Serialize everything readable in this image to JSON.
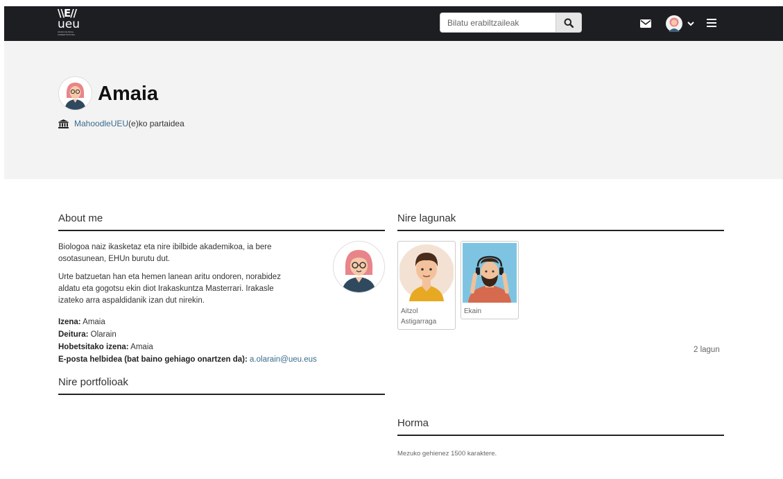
{
  "navbar": {
    "logo": {
      "mark": "\\\\E//",
      "text": "ueu",
      "tagline": "UDAKO EUSKAL UNIBERTSITATEA"
    },
    "search": {
      "placeholder": "Bilatu erabiltzaileak"
    },
    "icons": {
      "search": "search-icon",
      "messages": "envelope-icon",
      "user_menu": "chevron-down-icon",
      "menu": "hamburger-icon"
    },
    "bg_color": "#1d1e22"
  },
  "header": {
    "title": "Amaia",
    "institution_link": "MahoodleUEU",
    "institution_suffix": "(e)ko partaidea",
    "bg_color": "#f3f3f3"
  },
  "about": {
    "title": "About me",
    "paragraphs": [
      "Biologoa naiz ikasketaz eta nire ibilbide akademikoa, ia bere osotasunean, EHUn burutu dut.",
      "Urte batzuetan han eta hemen lanean aritu ondoren, norabidez aldatu eta gogotsu ekin diot Irakaskuntza Masterrari. Irakasle izateko arra aspaldidanik izan dut nirekin."
    ],
    "fields": [
      {
        "label": "Izena:",
        "value": "Amaia"
      },
      {
        "label": "Deitura:",
        "value": "Olarain"
      },
      {
        "label": "Hobetsitako izena:",
        "value": "Amaia"
      }
    ],
    "email_label": "E-posta helbidea (bat baino gehiago onartzen da):",
    "email_value": "a.olarain@ueu.eus"
  },
  "portfolios": {
    "title": "Nire portfolioak"
  },
  "friends": {
    "title": "Nire lagunak",
    "items": [
      {
        "name_line1": "Aitzol",
        "name_line2": "Astigarraga"
      },
      {
        "name_line1": "Ekain",
        "name_line2": ""
      }
    ],
    "count": "2 lagun"
  },
  "wall": {
    "title": "Horma",
    "note": "Mezuko gehienez 1500 karaktere."
  },
  "colors": {
    "link": "#3a6b8c",
    "text": "#333333"
  }
}
